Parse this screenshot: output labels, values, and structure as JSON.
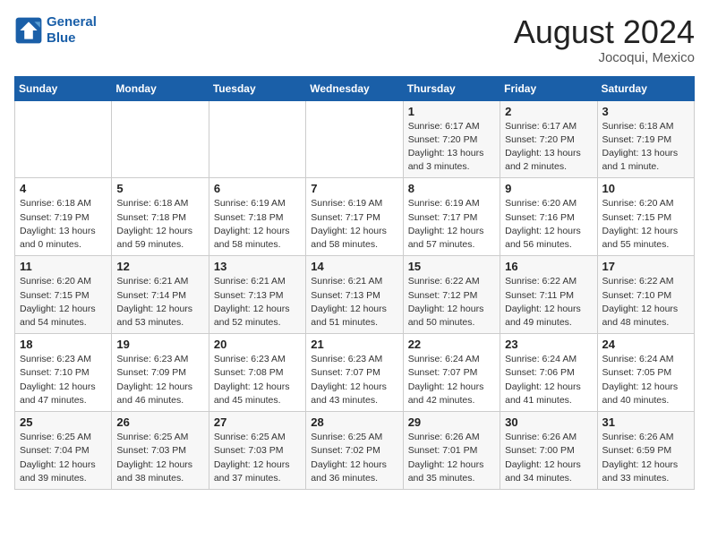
{
  "header": {
    "logo_line1": "General",
    "logo_line2": "Blue",
    "month_year": "August 2024",
    "location": "Jocoqui, Mexico"
  },
  "weekdays": [
    "Sunday",
    "Monday",
    "Tuesday",
    "Wednesday",
    "Thursday",
    "Friday",
    "Saturday"
  ],
  "weeks": [
    [
      {
        "day": "",
        "content": ""
      },
      {
        "day": "",
        "content": ""
      },
      {
        "day": "",
        "content": ""
      },
      {
        "day": "",
        "content": ""
      },
      {
        "day": "1",
        "content": "Sunrise: 6:17 AM\nSunset: 7:20 PM\nDaylight: 13 hours\nand 3 minutes."
      },
      {
        "day": "2",
        "content": "Sunrise: 6:17 AM\nSunset: 7:20 PM\nDaylight: 13 hours\nand 2 minutes."
      },
      {
        "day": "3",
        "content": "Sunrise: 6:18 AM\nSunset: 7:19 PM\nDaylight: 13 hours\nand 1 minute."
      }
    ],
    [
      {
        "day": "4",
        "content": "Sunrise: 6:18 AM\nSunset: 7:19 PM\nDaylight: 13 hours\nand 0 minutes."
      },
      {
        "day": "5",
        "content": "Sunrise: 6:18 AM\nSunset: 7:18 PM\nDaylight: 12 hours\nand 59 minutes."
      },
      {
        "day": "6",
        "content": "Sunrise: 6:19 AM\nSunset: 7:18 PM\nDaylight: 12 hours\nand 58 minutes."
      },
      {
        "day": "7",
        "content": "Sunrise: 6:19 AM\nSunset: 7:17 PM\nDaylight: 12 hours\nand 58 minutes."
      },
      {
        "day": "8",
        "content": "Sunrise: 6:19 AM\nSunset: 7:17 PM\nDaylight: 12 hours\nand 57 minutes."
      },
      {
        "day": "9",
        "content": "Sunrise: 6:20 AM\nSunset: 7:16 PM\nDaylight: 12 hours\nand 56 minutes."
      },
      {
        "day": "10",
        "content": "Sunrise: 6:20 AM\nSunset: 7:15 PM\nDaylight: 12 hours\nand 55 minutes."
      }
    ],
    [
      {
        "day": "11",
        "content": "Sunrise: 6:20 AM\nSunset: 7:15 PM\nDaylight: 12 hours\nand 54 minutes."
      },
      {
        "day": "12",
        "content": "Sunrise: 6:21 AM\nSunset: 7:14 PM\nDaylight: 12 hours\nand 53 minutes."
      },
      {
        "day": "13",
        "content": "Sunrise: 6:21 AM\nSunset: 7:13 PM\nDaylight: 12 hours\nand 52 minutes."
      },
      {
        "day": "14",
        "content": "Sunrise: 6:21 AM\nSunset: 7:13 PM\nDaylight: 12 hours\nand 51 minutes."
      },
      {
        "day": "15",
        "content": "Sunrise: 6:22 AM\nSunset: 7:12 PM\nDaylight: 12 hours\nand 50 minutes."
      },
      {
        "day": "16",
        "content": "Sunrise: 6:22 AM\nSunset: 7:11 PM\nDaylight: 12 hours\nand 49 minutes."
      },
      {
        "day": "17",
        "content": "Sunrise: 6:22 AM\nSunset: 7:10 PM\nDaylight: 12 hours\nand 48 minutes."
      }
    ],
    [
      {
        "day": "18",
        "content": "Sunrise: 6:23 AM\nSunset: 7:10 PM\nDaylight: 12 hours\nand 47 minutes."
      },
      {
        "day": "19",
        "content": "Sunrise: 6:23 AM\nSunset: 7:09 PM\nDaylight: 12 hours\nand 46 minutes."
      },
      {
        "day": "20",
        "content": "Sunrise: 6:23 AM\nSunset: 7:08 PM\nDaylight: 12 hours\nand 45 minutes."
      },
      {
        "day": "21",
        "content": "Sunrise: 6:23 AM\nSunset: 7:07 PM\nDaylight: 12 hours\nand 43 minutes."
      },
      {
        "day": "22",
        "content": "Sunrise: 6:24 AM\nSunset: 7:07 PM\nDaylight: 12 hours\nand 42 minutes."
      },
      {
        "day": "23",
        "content": "Sunrise: 6:24 AM\nSunset: 7:06 PM\nDaylight: 12 hours\nand 41 minutes."
      },
      {
        "day": "24",
        "content": "Sunrise: 6:24 AM\nSunset: 7:05 PM\nDaylight: 12 hours\nand 40 minutes."
      }
    ],
    [
      {
        "day": "25",
        "content": "Sunrise: 6:25 AM\nSunset: 7:04 PM\nDaylight: 12 hours\nand 39 minutes."
      },
      {
        "day": "26",
        "content": "Sunrise: 6:25 AM\nSunset: 7:03 PM\nDaylight: 12 hours\nand 38 minutes."
      },
      {
        "day": "27",
        "content": "Sunrise: 6:25 AM\nSunset: 7:03 PM\nDaylight: 12 hours\nand 37 minutes."
      },
      {
        "day": "28",
        "content": "Sunrise: 6:25 AM\nSunset: 7:02 PM\nDaylight: 12 hours\nand 36 minutes."
      },
      {
        "day": "29",
        "content": "Sunrise: 6:26 AM\nSunset: 7:01 PM\nDaylight: 12 hours\nand 35 minutes."
      },
      {
        "day": "30",
        "content": "Sunrise: 6:26 AM\nSunset: 7:00 PM\nDaylight: 12 hours\nand 34 minutes."
      },
      {
        "day": "31",
        "content": "Sunrise: 6:26 AM\nSunset: 6:59 PM\nDaylight: 12 hours\nand 33 minutes."
      }
    ]
  ]
}
